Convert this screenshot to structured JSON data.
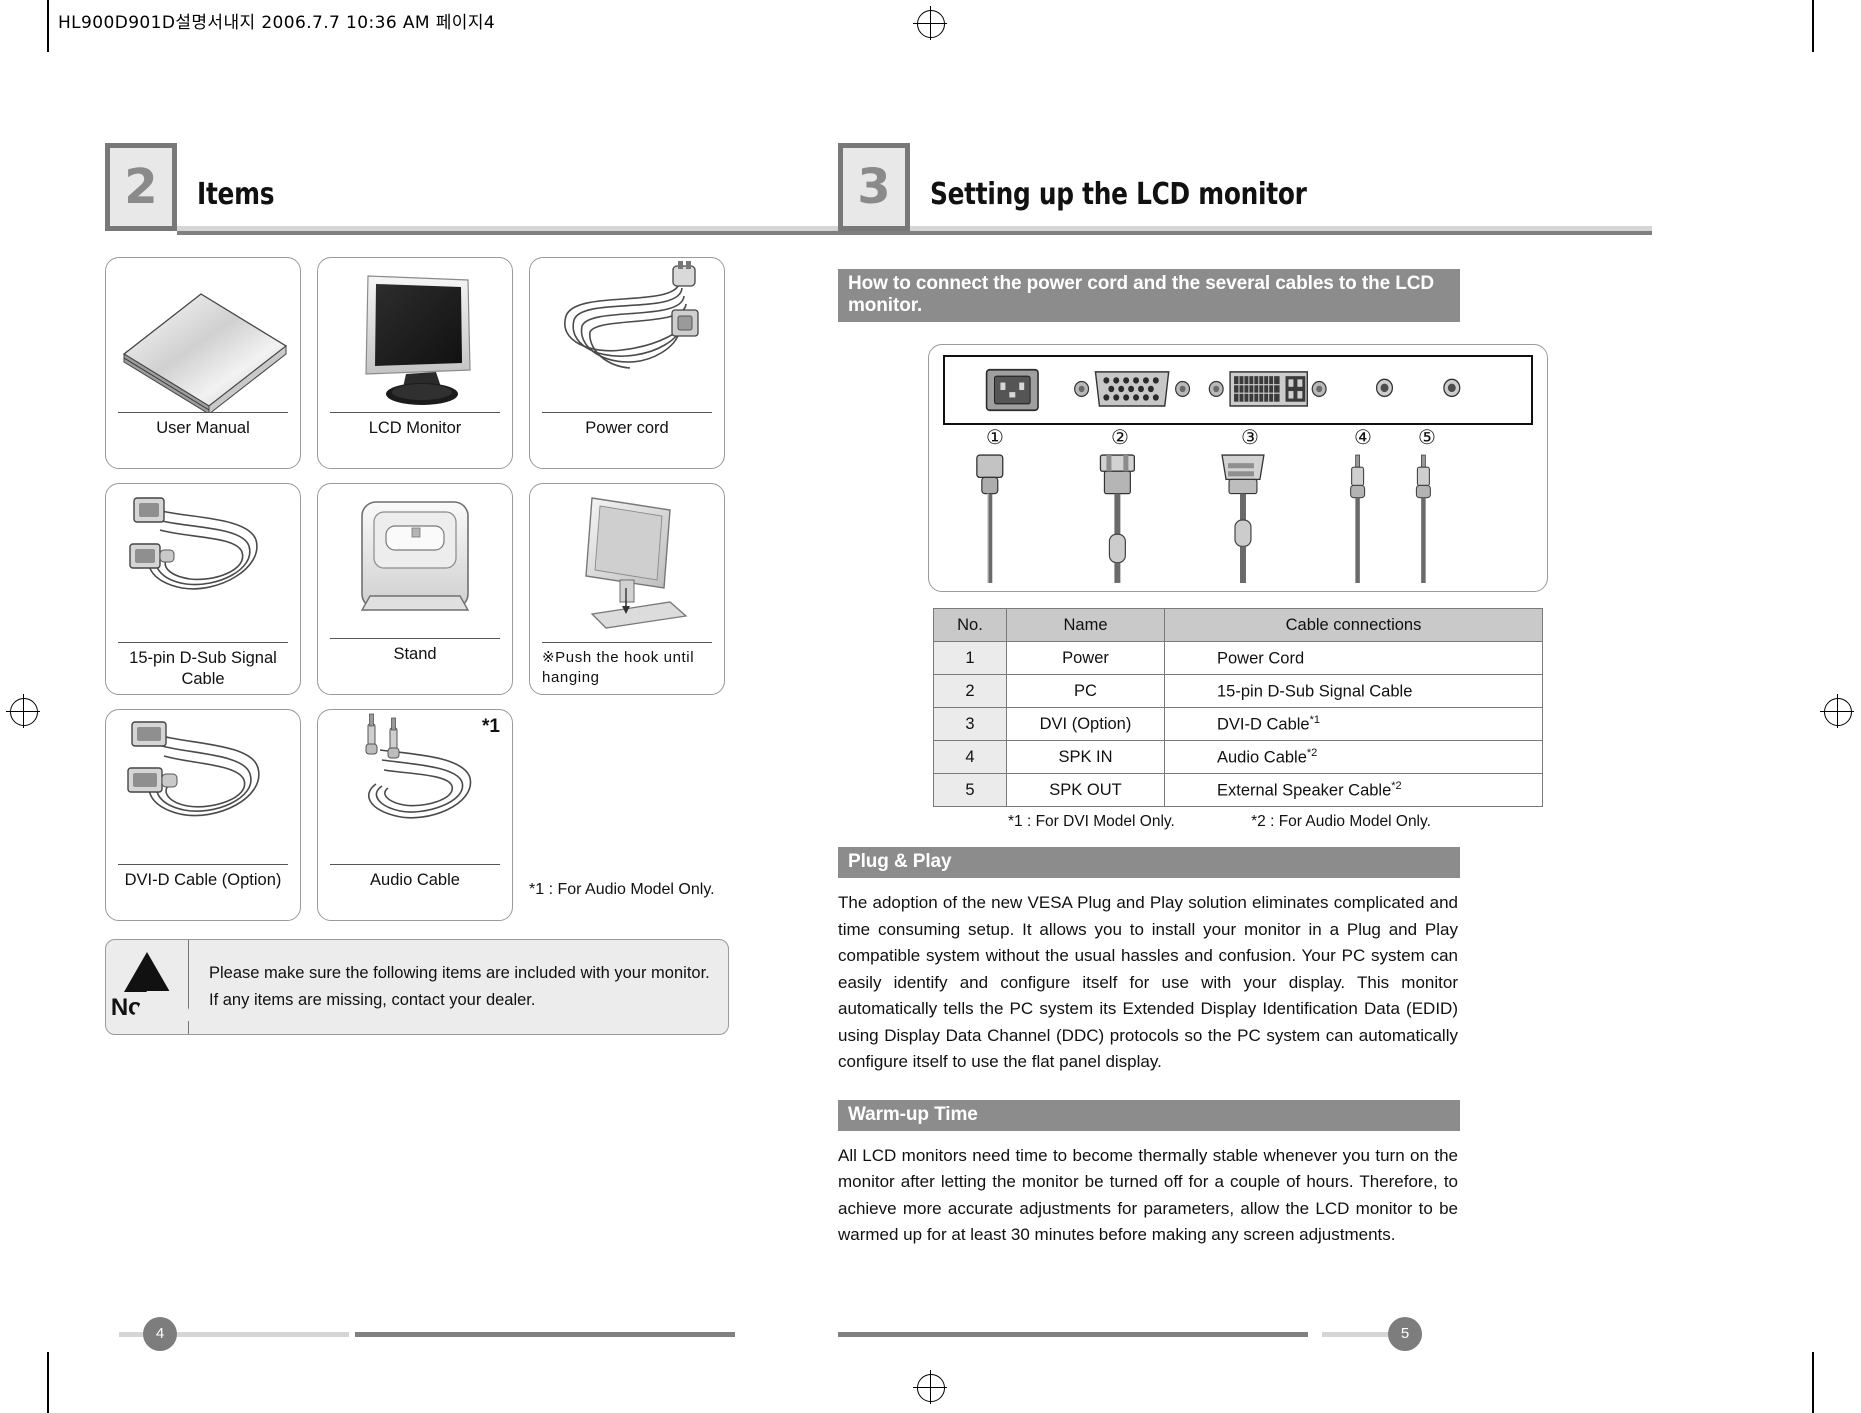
{
  "file_header": "HL900D901D설명서내지  2006.7.7 10:36 AM  페이지4",
  "left_page": {
    "section": {
      "number": "2",
      "title": "Items"
    },
    "items": [
      {
        "label": "User Manual",
        "art": "manual"
      },
      {
        "label": "LCD Monitor",
        "art": "monitor"
      },
      {
        "label": "Power cord",
        "art": "powercord"
      },
      {
        "label": "15-pin D-Sub Signal\nCable",
        "art": "dsub"
      },
      {
        "label": "Stand",
        "art": "stand"
      },
      {
        "label": "※Push  the  hook  until\n  hanging",
        "art": "hook"
      },
      {
        "label": "DVI-D Cable (Option)",
        "art": "dvi"
      },
      {
        "label": "Audio Cable",
        "art": "audio"
      }
    ],
    "audio_star": "*1",
    "audio_footnote": "*1 : For Audio Model Only.",
    "notice": {
      "word": "Notice",
      "lines": [
        "Please make sure the following items are included with your monitor.",
        "If any items are missing, contact your dealer."
      ]
    },
    "page_number": "4"
  },
  "right_page": {
    "section": {
      "number": "3",
      "title": "Setting up the LCD monitor"
    },
    "connect_bar": "How to connect the power cord and the several cables to the LCD monitor.",
    "connector_numbers": [
      "①",
      "②",
      "③",
      "④",
      "⑤"
    ],
    "table": {
      "headers": [
        "No.",
        "Name",
        "Cable connections"
      ],
      "rows": [
        {
          "no": "1",
          "name": "Power",
          "cable": "Power Cord",
          "sup": ""
        },
        {
          "no": "2",
          "name": "PC",
          "cable": "15-pin D-Sub Signal Cable",
          "sup": ""
        },
        {
          "no": "3",
          "name": "DVI (Option)",
          "cable": "DVI-D Cable",
          "sup": "*1"
        },
        {
          "no": "4",
          "name": "SPK IN",
          "cable": "Audio Cable",
          "sup": "*2"
        },
        {
          "no": "5",
          "name": "SPK OUT",
          "cable": "External Speaker Cable",
          "sup": "*2"
        }
      ],
      "footnote1": "*1 : For DVI Model Only.",
      "footnote2": "*2 : For Audio Model Only."
    },
    "plug_play": {
      "heading": "Plug & Play",
      "body": "The adoption of the new VESA Plug and Play solution eliminates complicated and time consuming setup. It allows you to install your monitor in a Plug and Play compatible system without the usual hassles and confusion. Your PC system can easily identify and configure itself for use with your display. This monitor automatically tells the PC system its Extended Display Identification Data (EDID) using Display Data Channel (DDC) protocols so the PC system can automatically configure itself to use the flat panel display."
    },
    "warm_up": {
      "heading": "Warm-up Time",
      "body": " All LCD monitors need time to become thermally stable whenever you turn on the monitor after letting the monitor be turned off for a couple of hours. Therefore, to achieve more accurate adjustments for parameters, allow the LCD monitor to be warmed up for at least 30 minutes before making any screen adjustments."
    },
    "page_number": "5"
  },
  "colors": {
    "bar_gray": "#8c8c8c",
    "section_box_border": "#787878",
    "section_box_fill": "#e8e8e8",
    "table_header": "#c9c9c9",
    "notice_fill": "#ececec"
  }
}
